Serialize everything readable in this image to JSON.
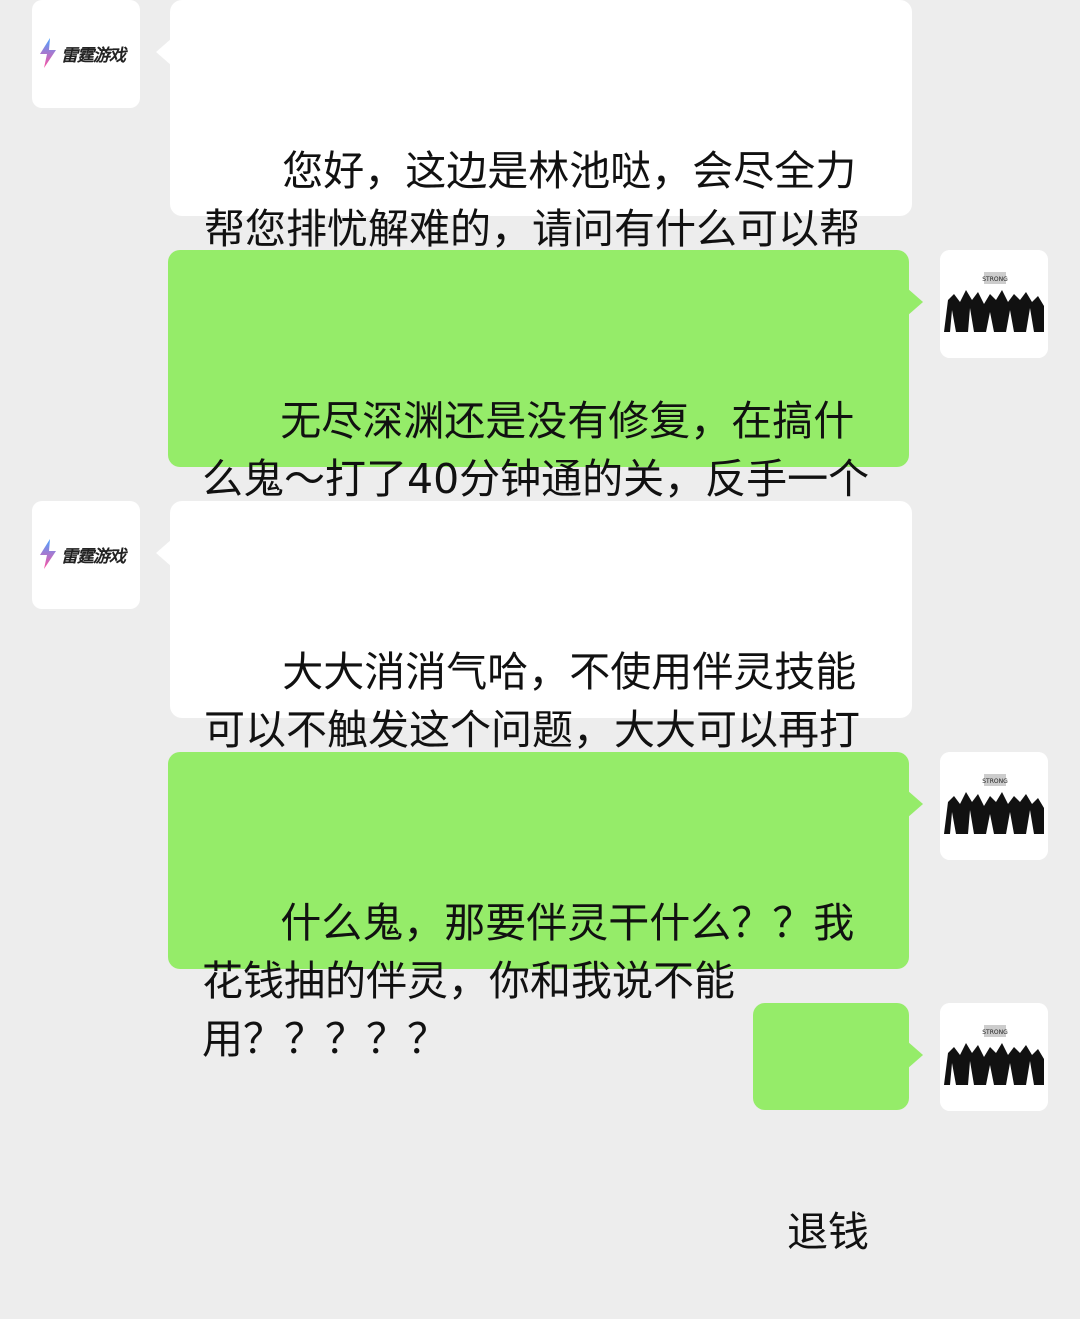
{
  "contact": {
    "bot_logo_text": "雷霆游戏"
  },
  "messages": [
    {
      "sender": "bot",
      "text": "您好，这边是林池哒，会尽全力帮您排忧解难的，请问有什么可以帮您嘛"
    },
    {
      "sender": "user",
      "text": "无尽深渊还是没有修复，在搞什么鬼～打了40分钟通的关，反手一个战场矫正搞没了！！！"
    },
    {
      "sender": "bot",
      "text": "大大消消气哈，不使用伴灵技能可以不触发这个问题，大大可以再打一下试试哈"
    },
    {
      "sender": "user",
      "text": "什么鬼，那要伴灵干什么？？我花钱抽的伴灵，你和我说不能用？？？？？"
    },
    {
      "sender": "user",
      "text": "退钱"
    }
  ],
  "colors": {
    "background": "#ededed",
    "user_bubble": "#95ec69",
    "bot_bubble": "#ffffff",
    "logo_gradient_top": "#4aa3ff",
    "logo_gradient_bottom": "#ff4fa0"
  },
  "icons": {
    "bot_avatar": "thunder-games-logo-icon",
    "user_avatar": "user-avatar-image-icon"
  }
}
